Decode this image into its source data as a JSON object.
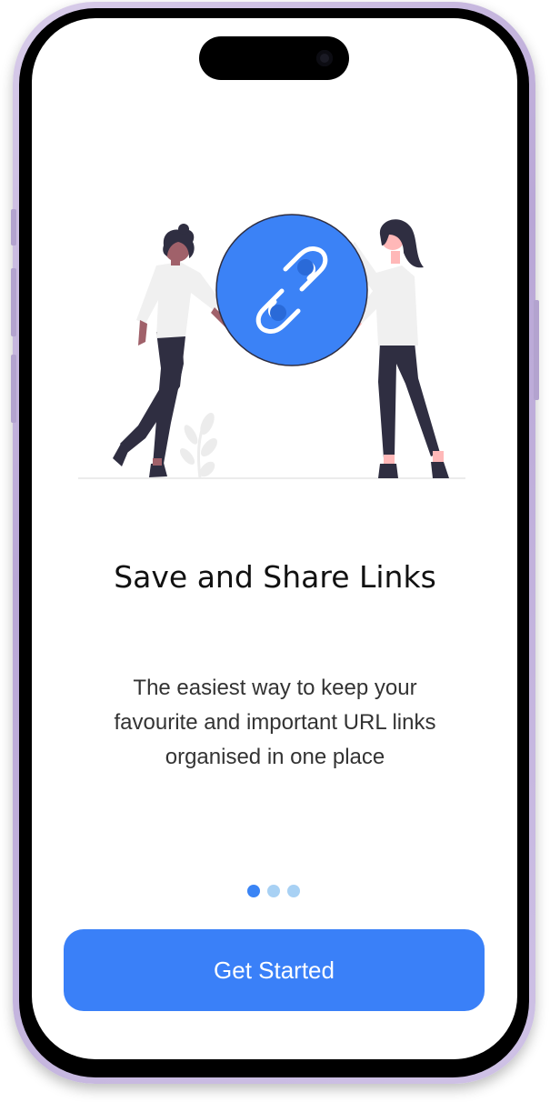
{
  "onboarding": {
    "headline": "Save and Share Links",
    "description": "The easiest way to keep your favourite and important URL links organised in one place",
    "pager": {
      "total_pages": 3,
      "active_page": 1
    },
    "cta_label": "Get Started"
  },
  "colors": {
    "accent": "#3A80F8",
    "dot_active": "#3A84F5",
    "dot_inactive": "#A8D1F4",
    "illustration_circle": "#3B82F6"
  },
  "icons": {
    "illustration": "people-holding-link-illustration",
    "link": "link-icon"
  }
}
